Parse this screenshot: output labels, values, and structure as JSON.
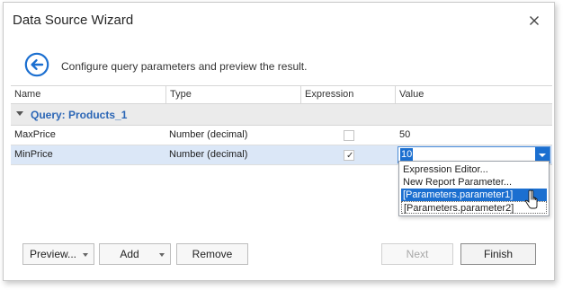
{
  "window": {
    "title": "Data Source Wizard",
    "close_icon": "close-icon"
  },
  "header": {
    "back_icon": "back-arrow-icon",
    "text": "Configure query parameters and preview the result.",
    "accent": "#1b6fd0"
  },
  "grid": {
    "columns": [
      "Name",
      "Type",
      "Expression",
      "Value"
    ],
    "group_label": "Query: Products_1",
    "rows": [
      {
        "name": "MaxPrice",
        "type": "Number (decimal)",
        "expression": false,
        "value": "50"
      },
      {
        "name": "MinPrice",
        "type": "Number (decimal)",
        "expression": true,
        "value": "10",
        "selected": true
      }
    ],
    "checkmark": "✓"
  },
  "value_dropdown": {
    "items": [
      "Expression Editor...",
      "New Report Parameter...",
      "[Parameters.parameter1]",
      "[Parameters.parameter2]"
    ],
    "highlighted_index": 2
  },
  "footer": {
    "preview_label": "Preview...",
    "add_label": "Add",
    "remove_label": "Remove",
    "next_label": "Next",
    "finish_label": "Finish"
  },
  "colors": {
    "selection": "#1b6fd0",
    "row_selected_bg": "#dbe7f7",
    "group_text": "#2b66b6",
    "group_bg": "#ebebeb"
  }
}
